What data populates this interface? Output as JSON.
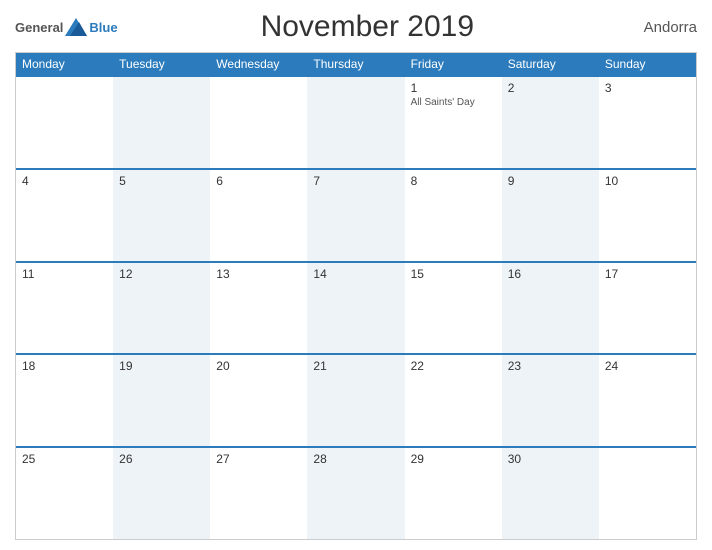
{
  "header": {
    "title": "November 2019",
    "country": "Andorra",
    "logo": {
      "general": "General",
      "blue": "Blue"
    }
  },
  "dayHeaders": [
    "Monday",
    "Tuesday",
    "Wednesday",
    "Thursday",
    "Friday",
    "Saturday",
    "Sunday"
  ],
  "weeks": [
    [
      {
        "num": "",
        "event": ""
      },
      {
        "num": "",
        "event": ""
      },
      {
        "num": "",
        "event": ""
      },
      {
        "num": "",
        "event": ""
      },
      {
        "num": "1",
        "event": "All Saints' Day"
      },
      {
        "num": "2",
        "event": ""
      },
      {
        "num": "3",
        "event": ""
      }
    ],
    [
      {
        "num": "4",
        "event": ""
      },
      {
        "num": "5",
        "event": ""
      },
      {
        "num": "6",
        "event": ""
      },
      {
        "num": "7",
        "event": ""
      },
      {
        "num": "8",
        "event": ""
      },
      {
        "num": "9",
        "event": ""
      },
      {
        "num": "10",
        "event": ""
      }
    ],
    [
      {
        "num": "11",
        "event": ""
      },
      {
        "num": "12",
        "event": ""
      },
      {
        "num": "13",
        "event": ""
      },
      {
        "num": "14",
        "event": ""
      },
      {
        "num": "15",
        "event": ""
      },
      {
        "num": "16",
        "event": ""
      },
      {
        "num": "17",
        "event": ""
      }
    ],
    [
      {
        "num": "18",
        "event": ""
      },
      {
        "num": "19",
        "event": ""
      },
      {
        "num": "20",
        "event": ""
      },
      {
        "num": "21",
        "event": ""
      },
      {
        "num": "22",
        "event": ""
      },
      {
        "num": "23",
        "event": ""
      },
      {
        "num": "24",
        "event": ""
      }
    ],
    [
      {
        "num": "25",
        "event": ""
      },
      {
        "num": "26",
        "event": ""
      },
      {
        "num": "27",
        "event": ""
      },
      {
        "num": "28",
        "event": ""
      },
      {
        "num": "29",
        "event": ""
      },
      {
        "num": "30",
        "event": ""
      },
      {
        "num": "",
        "event": ""
      }
    ]
  ],
  "colors": {
    "headerBg": "#2b7bbd",
    "headerText": "#ffffff",
    "accentBlue": "#2b7bbd"
  }
}
